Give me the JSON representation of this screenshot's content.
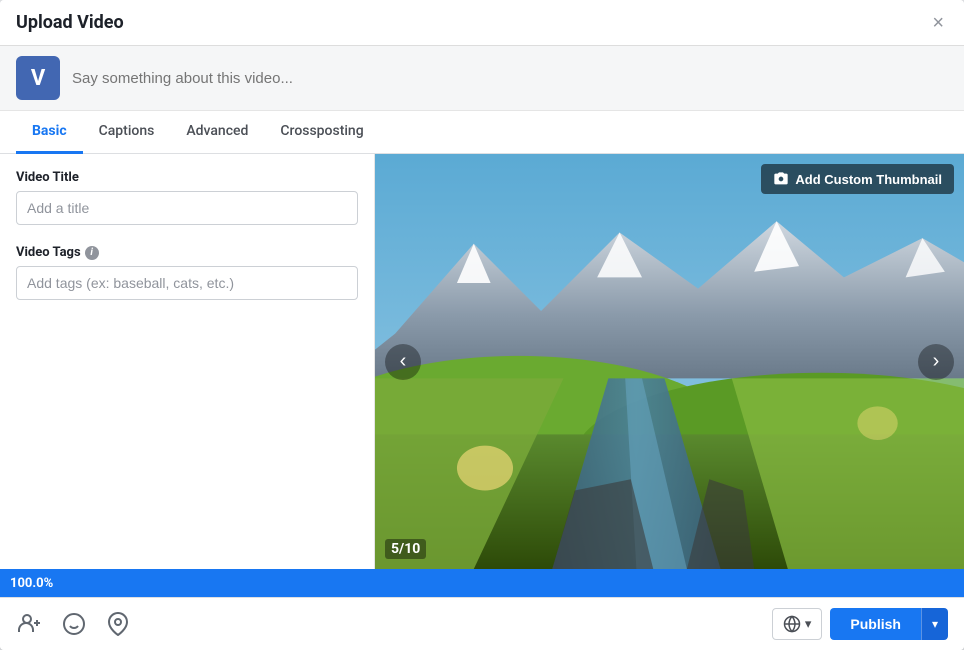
{
  "modal": {
    "title": "Upload Video",
    "close_label": "×"
  },
  "status_bar": {
    "avatar_letter": "V",
    "placeholder": "Say something about this video..."
  },
  "tabs": [
    {
      "id": "basic",
      "label": "Basic",
      "active": true
    },
    {
      "id": "captions",
      "label": "Captions",
      "active": false
    },
    {
      "id": "advanced",
      "label": "Advanced",
      "active": false
    },
    {
      "id": "crossposting",
      "label": "Crossposting",
      "active": false
    }
  ],
  "left_panel": {
    "video_title_label": "Video Title",
    "video_title_placeholder": "Add a title",
    "video_tags_label": "Video Tags",
    "video_tags_info": "i",
    "video_tags_placeholder": "Add tags (ex: baseball, cats, etc.)"
  },
  "video": {
    "thumbnail_btn_label": "Add Custom Thumbnail",
    "nav_left": "‹",
    "nav_right": "›",
    "slide_counter": "5/10"
  },
  "progress": {
    "value": 100,
    "label": "100.0%"
  },
  "footer": {
    "icons": [
      {
        "name": "tag-people-icon",
        "symbol": "👤+",
        "label": "Tag people"
      },
      {
        "name": "emoji-icon",
        "symbol": "😊",
        "label": "Emoji"
      },
      {
        "name": "location-icon",
        "symbol": "📍",
        "label": "Location"
      }
    ],
    "audience_icon": "🌐",
    "audience_arrow": "▾",
    "publish_label": "Publish",
    "publish_dropdown_arrow": "▾"
  }
}
